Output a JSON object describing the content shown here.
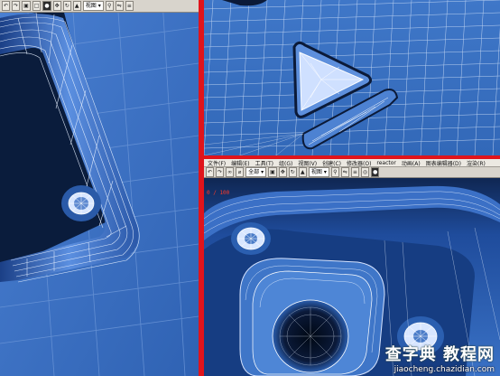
{
  "left_toolbar": {
    "select_value": "视图",
    "buttons": [
      "undo",
      "redo",
      "select",
      "region",
      "move",
      "rotate",
      "scale",
      "snap",
      "mirror",
      "align",
      "material",
      "render"
    ]
  },
  "bottom_right_toolbar": {
    "menu_items": [
      "文件(F)",
      "编辑(E)",
      "工具(T)",
      "组(G)",
      "视图(V)",
      "创建(C)",
      "修改器(O)",
      "reactor",
      "动画(A)",
      "图表编辑器(D)",
      "渲染(R)",
      "自定义(U)",
      "MAXScript(M)",
      "帮助(H)"
    ],
    "select_value": "全部",
    "view_value": "视图",
    "frame_label": "0 / 100"
  },
  "watermark": {
    "title": "查字典 教程网",
    "url": "jiaocheng.chazidian.com"
  },
  "colors": {
    "viewport_blue": "#3a6fc0",
    "divider_red": "#e0141b",
    "wire_white": "#e6f0ff"
  },
  "icons": [
    "undo-icon",
    "redo-icon",
    "select-icon",
    "move-icon",
    "rotate-icon",
    "scale-icon",
    "snap-icon",
    "mirror-icon",
    "align-icon",
    "render-icon"
  ]
}
